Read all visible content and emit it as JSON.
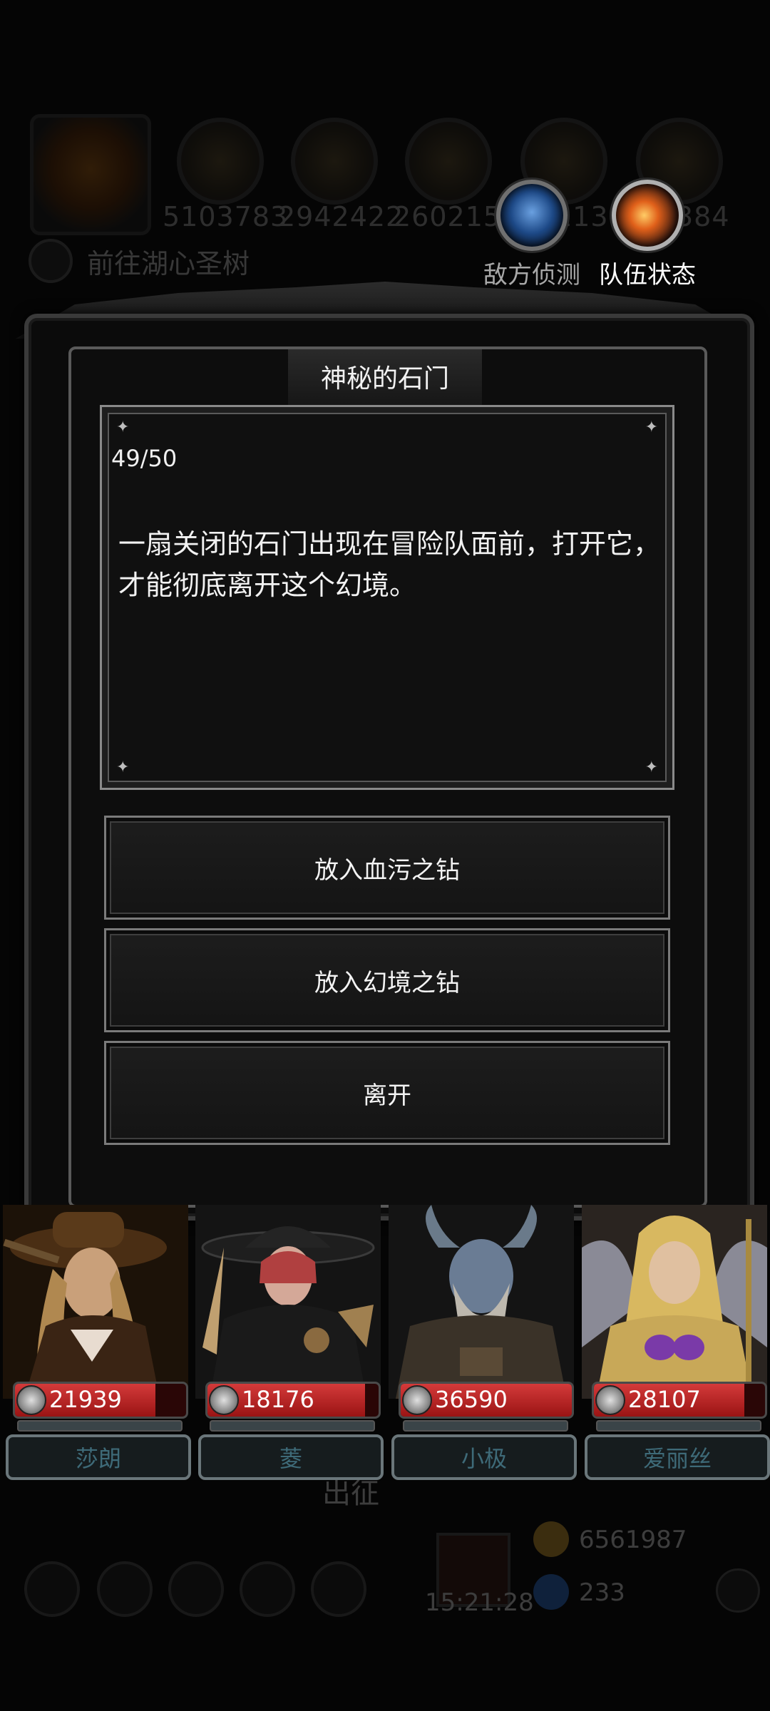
{
  "background": {
    "resources": [
      "5103783",
      "2942422",
      "2602154",
      "113",
      "384"
    ],
    "quest_label": "前往湖心圣树",
    "depart_label": "出征",
    "timer": "15:21:28",
    "gold": "6561987",
    "gems": "233"
  },
  "top_buttons": {
    "scout_label": "敌方侦测",
    "team_label": "队伍状态"
  },
  "dialog": {
    "title": "神秘的石门",
    "progress": "49/50",
    "story": "一扇关闭的石门出现在冒险队面前，打开它，才能彻底离开这个幻境。",
    "options": [
      "放入血污之钻",
      "放入幻境之钻",
      "离开"
    ]
  },
  "heroes": [
    {
      "name": "莎朗",
      "hp": "21939",
      "hp_fill": 0.82,
      "art": "cowboy-hat-gunslinger"
    },
    {
      "name": "菱",
      "hp": "18176",
      "hp_fill": 0.92,
      "art": "wide-hat-assassin"
    },
    {
      "name": "小极",
      "hp": "36590",
      "hp_fill": 1.0,
      "art": "horned-blue-warrior"
    },
    {
      "name": "爱丽丝",
      "hp": "28107",
      "hp_fill": 0.88,
      "art": "golden-winged-priestess"
    }
  ],
  "colors": {
    "hp_red": "#c42a2a",
    "name_text": "#3e6a78",
    "frame": "#5a5a5a"
  }
}
